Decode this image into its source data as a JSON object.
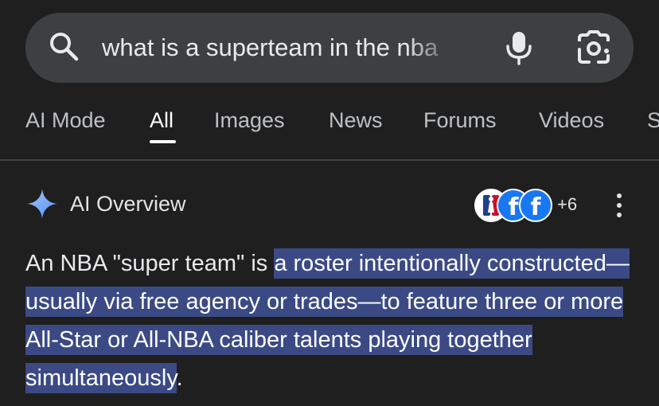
{
  "search": {
    "query": "what is a superteam in the nba",
    "icons": [
      "search-icon",
      "microphone-icon",
      "google-lens-icon"
    ]
  },
  "tabs": [
    {
      "label": "AI Mode",
      "active": false
    },
    {
      "label": "All",
      "active": true
    },
    {
      "label": "Images",
      "active": false
    },
    {
      "label": "News",
      "active": false
    },
    {
      "label": "Forums",
      "active": false
    },
    {
      "label": "Videos",
      "active": false
    },
    {
      "label": "S",
      "active": false
    }
  ],
  "ai_overview": {
    "title": "AI Overview",
    "sources_extra": "+6",
    "source_icons": [
      "nba-logo",
      "facebook-logo",
      "facebook-logo"
    ],
    "text_before": "An NBA \"super team\" is ",
    "text_highlight": "a roster intentionally constructed—usually via free agency or trades—to feature three or more All-Star or All-NBA caliber talents playing together simultaneously",
    "text_after": ".",
    "highlight_color": "#3b4a85"
  },
  "colors": {
    "background": "#1f1f1f",
    "search_bar": "#3c4043",
    "tab_inactive": "#bdc1c6",
    "tab_active": "#ffffff",
    "gemini_blue": "#8ab4f8"
  }
}
